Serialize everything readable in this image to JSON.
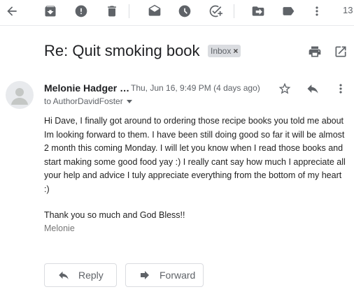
{
  "toolbar": {
    "icons": [
      "back-arrow-icon",
      "archive-icon",
      "report-spam-icon",
      "delete-icon",
      "mark-unread-icon",
      "snooze-icon",
      "add-task-icon",
      "move-to-icon",
      "labels-icon",
      "more-vert-icon"
    ],
    "count": "13"
  },
  "email": {
    "subject": "Re: Quit smoking book",
    "label": "Inbox",
    "label_remove": "×",
    "sender": "Melonie Hadger …",
    "date": "Thu, Jun 16, 9:49 PM (4 days ago)",
    "recipient": "to AuthorDavidFoster",
    "body": "Hi Dave, I finally got around to ordering those recipe books you told me about Im looking forward to them. I have been still doing good so far it will be almost 2 month this coming Monday. I will let you know when I read those books and start making some good food yay :) I really cant say how much I appreciate all your help and advice I tuly appreciate everything from the bottom of my heart :)",
    "thanks": "Thank you so much and God Bless!!",
    "signature": "Melonie"
  },
  "actions": {
    "reply": "Reply",
    "forward": "Forward"
  },
  "colors": {
    "icon": "#5f6368",
    "text": "#202124",
    "label_bg": "#dadce0",
    "border": "#dadce0"
  }
}
